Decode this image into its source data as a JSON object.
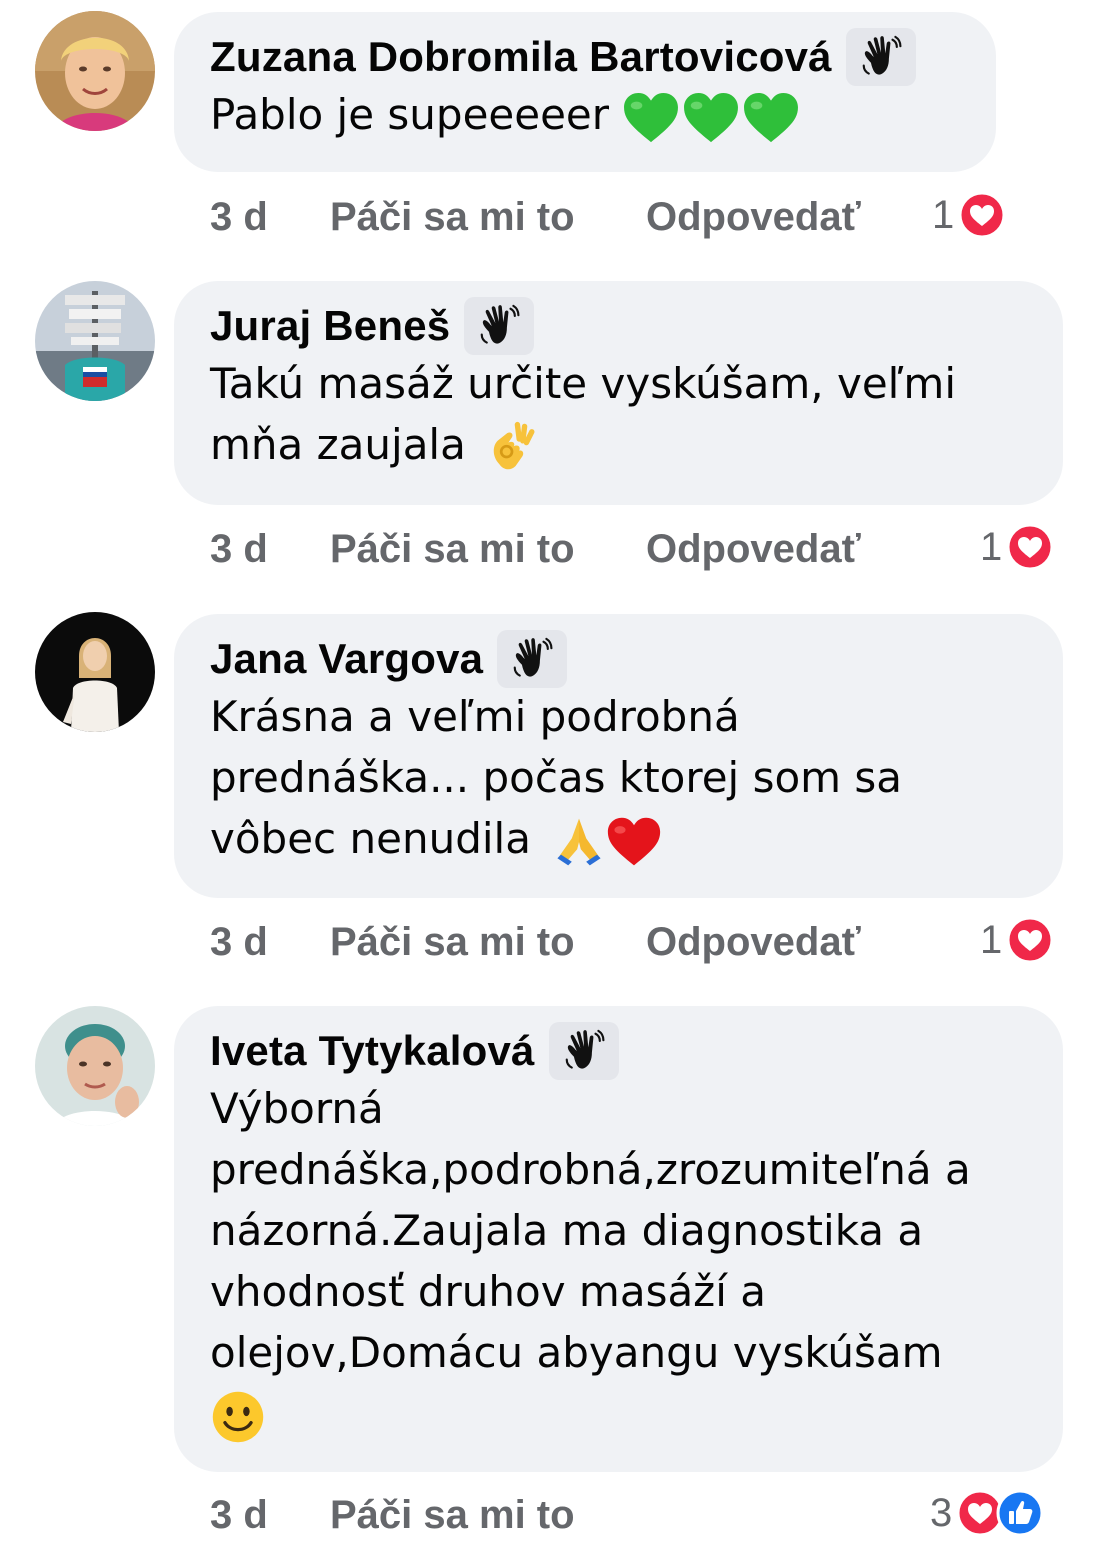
{
  "comments": [
    {
      "author": "Zuzana Dobromila Bartovicová",
      "badge_icon": "waving-hand-icon",
      "lines": [
        "Pablo je supeeeeer"
      ],
      "emojis": [
        "green-heart",
        "green-heart",
        "green-heart"
      ],
      "time": "3 d",
      "like_label": "Páči sa mi to",
      "reply_label": "Odpovedať",
      "reaction_count": "1",
      "reactions": [
        "love"
      ]
    },
    {
      "author": "Juraj Beneš",
      "badge_icon": "waving-hand-icon",
      "lines": [
        "Takú masáž určite vyskúšam, veľmi",
        "mňa zaujala"
      ],
      "emojis": [
        "ok-hand"
      ],
      "time": "3 d",
      "like_label": "Páči sa mi to",
      "reply_label": "Odpovedať",
      "reaction_count": "1",
      "reactions": [
        "love"
      ]
    },
    {
      "author": "Jana Vargova",
      "badge_icon": "waving-hand-icon",
      "lines": [
        "Krásna a veľmi podrobná",
        "prednáška... počas ktorej som sa",
        "vôbec nenudila"
      ],
      "emojis": [
        "folded-hands",
        "red-heart"
      ],
      "time": "3 d",
      "like_label": "Páči sa mi to",
      "reply_label": "Odpovedať",
      "reaction_count": "1",
      "reactions": [
        "love"
      ]
    },
    {
      "author": "Iveta Tytykalová",
      "badge_icon": "waving-hand-icon",
      "lines": [
        "Výborná",
        "prednáška,podrobná,zrozumiteľná a",
        "názorná.Zaujala ma diagnostika a",
        "vhodnosť druhov masáží a",
        "olejov,Domácu abyangu vyskúšam"
      ],
      "emojis": [
        "smiling-face"
      ],
      "time": "3 d",
      "like_label": "Páči sa mi to",
      "reply_label": "",
      "reaction_count": "3",
      "reactions": [
        "love",
        "like"
      ]
    }
  ],
  "colors": {
    "bubble": "#f0f2f5",
    "secondary_text": "#65676b",
    "love_red": "#f02849",
    "like_blue": "#1877f2"
  }
}
